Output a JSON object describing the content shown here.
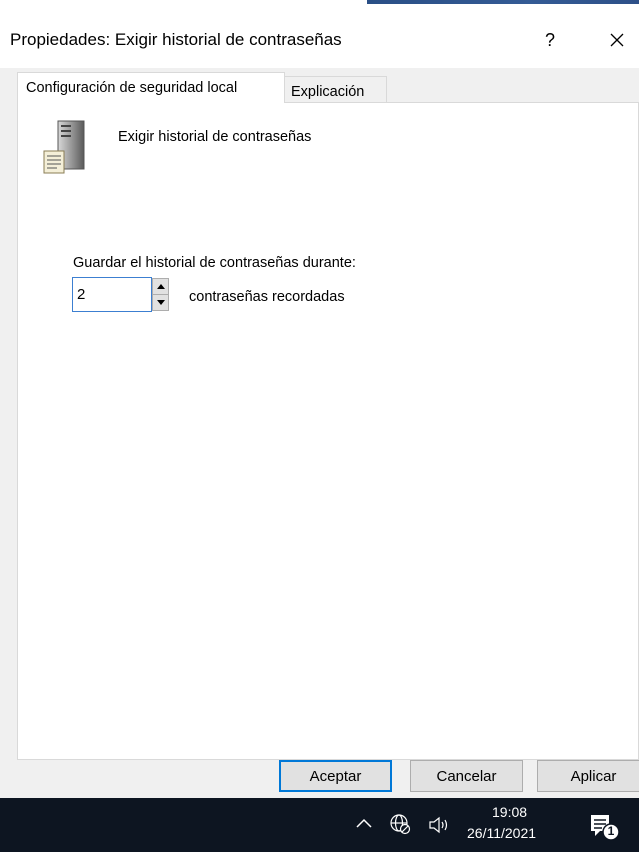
{
  "window": {
    "title": "Propiedades: Exigir historial de contraseñas",
    "help_glyph": "?",
    "close_icon": "close-icon",
    "accent_color": "#2a4f86"
  },
  "tabs": [
    {
      "label": "Configuración de seguridad local",
      "active": true
    },
    {
      "label": "Explicación",
      "active": false
    }
  ],
  "policy": {
    "icon": "server-policy-icon",
    "name": "Exigir historial de contraseñas"
  },
  "setting": {
    "label": "Guardar el historial de contraseñas durante:",
    "value": "2",
    "suffix": "contraseñas recordadas"
  },
  "buttons": {
    "ok": "Aceptar",
    "cancel": "Cancelar",
    "apply": "Aplicar"
  },
  "taskbar": {
    "time": "19:08",
    "date": "26/11/2021",
    "notification_count": "1",
    "icons": [
      "chevron-up-icon",
      "network-icon",
      "volume-icon",
      "notification-icon"
    ],
    "background": "#0d1521"
  }
}
